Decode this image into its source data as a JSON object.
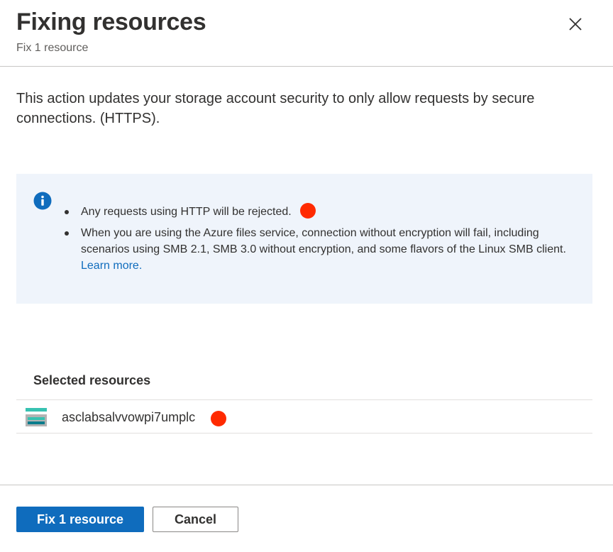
{
  "header": {
    "title": "Fixing resources",
    "subtitle": "Fix 1 resource",
    "close_icon": "close-icon"
  },
  "description": "This action updates your storage account security to only allow requests by secure connections. (HTTPS).",
  "info": {
    "icon": "info-icon",
    "items": [
      {
        "text": "Any requests using HTTP will be rejected."
      },
      {
        "text": "When you are using the Azure files service, connection without encryption will fail, including scenarios using SMB 2.1, SMB 3.0 without encryption, and some flavors of the Linux SMB client.",
        "link": "Learn more."
      }
    ]
  },
  "selected": {
    "title": "Selected resources",
    "resources": [
      {
        "icon": "storage-account-icon",
        "name": "asclabsalvvowpi7umplc"
      }
    ]
  },
  "footer": {
    "primary_label": "Fix 1 resource",
    "secondary_label": "Cancel"
  },
  "colors": {
    "primary": "#0f6cbd",
    "info_background": "#eff4fb",
    "marker_red": "#ff2a00",
    "text": "#323130"
  }
}
